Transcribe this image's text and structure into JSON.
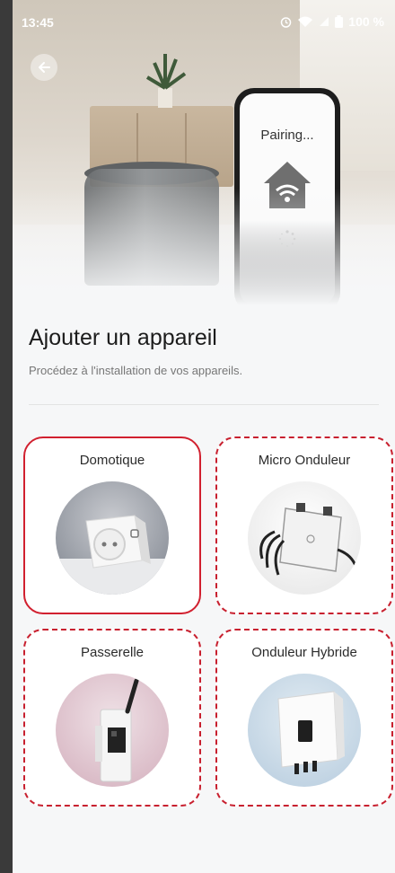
{
  "status_bar": {
    "time": "13:45",
    "battery": "100 %"
  },
  "hero": {
    "pairing_text": "Pairing..."
  },
  "page": {
    "title": "Ajouter un appareil",
    "subtitle": "Procédez à l'installation de vos appareils."
  },
  "devices": [
    {
      "label": "Domotique",
      "selected": true
    },
    {
      "label": "Micro Onduleur",
      "selected": false
    },
    {
      "label": "Passerelle",
      "selected": false
    },
    {
      "label": "Onduleur Hybride",
      "selected": false
    }
  ],
  "colors": {
    "accent": "#d1202f",
    "background": "#f6f7f8"
  },
  "icons": [
    "back-arrow-icon",
    "alarm-icon",
    "wifi-icon",
    "signal-icon",
    "battery-icon",
    "home-wifi-icon"
  ]
}
